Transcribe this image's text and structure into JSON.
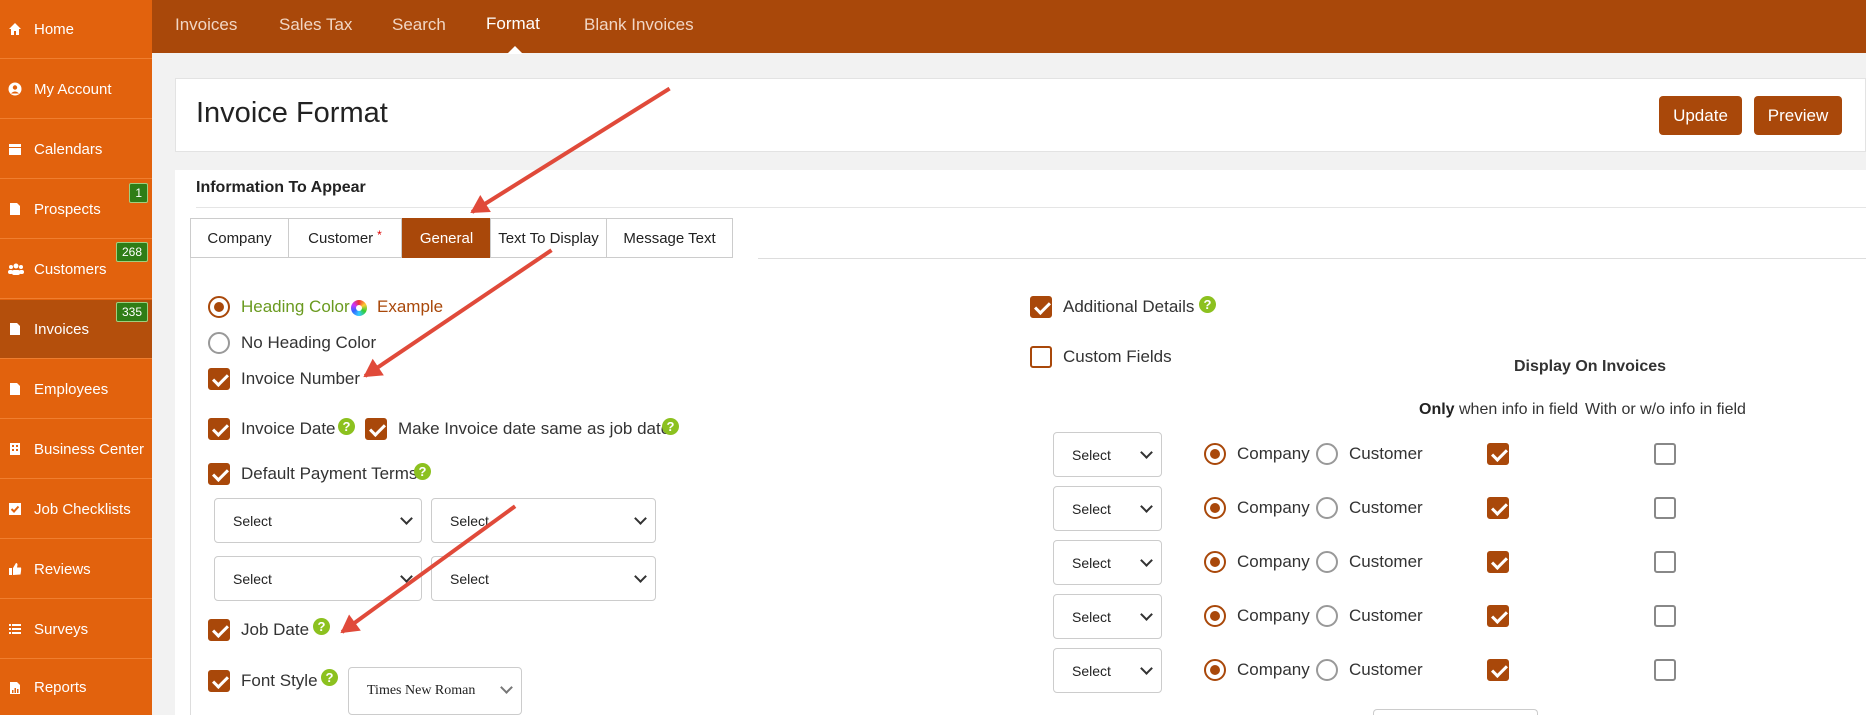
{
  "sidebar": {
    "items": [
      {
        "label": "Home",
        "icon": "home-icon"
      },
      {
        "label": "My Account",
        "icon": "user-circle-icon"
      },
      {
        "label": "Calendars",
        "icon": "calendar-icon"
      },
      {
        "label": "Prospects",
        "icon": "document-icon",
        "badge": "1"
      },
      {
        "label": "Customers",
        "icon": "users-icon",
        "badge": "268"
      },
      {
        "label": "Invoices",
        "icon": "document-icon",
        "badge": "335",
        "active": true
      },
      {
        "label": "Employees",
        "icon": "document-icon"
      },
      {
        "label": "Business Center",
        "icon": "building-icon"
      },
      {
        "label": "Job Checklists",
        "icon": "checkbox-icon"
      },
      {
        "label": "Reviews",
        "icon": "thumbs-up-icon"
      },
      {
        "label": "Surveys",
        "icon": "list-icon"
      },
      {
        "label": "Reports",
        "icon": "report-icon"
      }
    ]
  },
  "topnav": {
    "tabs": [
      {
        "label": "Invoices"
      },
      {
        "label": "Sales Tax"
      },
      {
        "label": "Search"
      },
      {
        "label": "Format",
        "active": true
      },
      {
        "label": "Blank Invoices"
      }
    ]
  },
  "header": {
    "title": "Invoice Format",
    "update_label": "Update",
    "preview_label": "Preview"
  },
  "section": {
    "title": "Information To Appear",
    "tabs": [
      {
        "label": "Company"
      },
      {
        "label": "Customer",
        "required": "*"
      },
      {
        "label": "General",
        "active": true
      },
      {
        "label": "Text To Display"
      },
      {
        "label": "Message Text"
      }
    ]
  },
  "general": {
    "heading_color_label": "Heading Color",
    "heading_color_example": "Example",
    "no_heading_color_label": "No Heading Color",
    "invoice_number_label": "Invoice Number",
    "invoice_date_label": "Invoice Date",
    "same_as_job_date_label": "Make Invoice date same as job date",
    "default_payment_terms_label": "Default Payment Terms",
    "payment_selects": [
      "Select",
      "Select",
      "Select",
      "Select"
    ],
    "job_date_label": "Job Date",
    "font_style_label": "Font Style",
    "font_style_value": "Times New Roman",
    "additional_details_label": "Additional Details",
    "custom_fields_label": "Custom Fields",
    "display_on_invoices_label": "Display On Invoices",
    "only_label": "Only",
    "when_info_label": "when info in field",
    "with_or_without_label": "With or w/o info in field",
    "custom_rows": [
      {
        "select": "Select",
        "company": "Company",
        "customer": "Customer",
        "only_checked": true,
        "always_checked": false
      },
      {
        "select": "Select",
        "company": "Company",
        "customer": "Customer",
        "only_checked": true,
        "always_checked": false
      },
      {
        "select": "Select",
        "company": "Company",
        "customer": "Customer",
        "only_checked": true,
        "always_checked": false
      },
      {
        "select": "Select",
        "company": "Company",
        "customer": "Customer",
        "only_checked": true,
        "always_checked": false
      },
      {
        "select": "Select",
        "company": "Company",
        "customer": "Customer",
        "only_checked": true,
        "always_checked": false
      }
    ]
  },
  "colors": {
    "sidebar": "#e2620d",
    "sidebar_active": "#b44f0c",
    "topbar": "#a9480a",
    "accent": "#a9480a",
    "badge": "#2f7d16",
    "help": "#8cc11f",
    "heading_color": "#6a9a1f",
    "example": "#a9480a",
    "annotation_arrow": "#e04a3a"
  }
}
